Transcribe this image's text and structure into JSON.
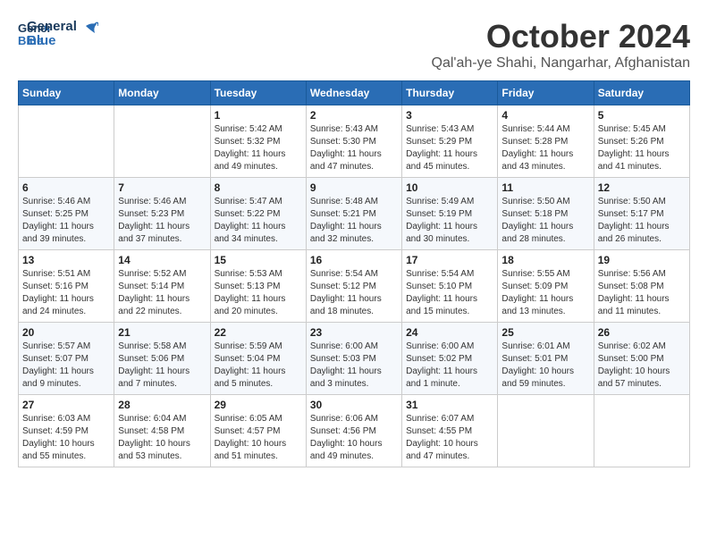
{
  "header": {
    "logo_line1": "General",
    "logo_line2": "Blue",
    "month": "October 2024",
    "location": "Qal'ah-ye Shahi, Nangarhar, Afghanistan"
  },
  "weekdays": [
    "Sunday",
    "Monday",
    "Tuesday",
    "Wednesday",
    "Thursday",
    "Friday",
    "Saturday"
  ],
  "weeks": [
    [
      {
        "day": "",
        "detail": ""
      },
      {
        "day": "",
        "detail": ""
      },
      {
        "day": "1",
        "detail": "Sunrise: 5:42 AM\nSunset: 5:32 PM\nDaylight: 11 hours and 49 minutes."
      },
      {
        "day": "2",
        "detail": "Sunrise: 5:43 AM\nSunset: 5:30 PM\nDaylight: 11 hours and 47 minutes."
      },
      {
        "day": "3",
        "detail": "Sunrise: 5:43 AM\nSunset: 5:29 PM\nDaylight: 11 hours and 45 minutes."
      },
      {
        "day": "4",
        "detail": "Sunrise: 5:44 AM\nSunset: 5:28 PM\nDaylight: 11 hours and 43 minutes."
      },
      {
        "day": "5",
        "detail": "Sunrise: 5:45 AM\nSunset: 5:26 PM\nDaylight: 11 hours and 41 minutes."
      }
    ],
    [
      {
        "day": "6",
        "detail": "Sunrise: 5:46 AM\nSunset: 5:25 PM\nDaylight: 11 hours and 39 minutes."
      },
      {
        "day": "7",
        "detail": "Sunrise: 5:46 AM\nSunset: 5:23 PM\nDaylight: 11 hours and 37 minutes."
      },
      {
        "day": "8",
        "detail": "Sunrise: 5:47 AM\nSunset: 5:22 PM\nDaylight: 11 hours and 34 minutes."
      },
      {
        "day": "9",
        "detail": "Sunrise: 5:48 AM\nSunset: 5:21 PM\nDaylight: 11 hours and 32 minutes."
      },
      {
        "day": "10",
        "detail": "Sunrise: 5:49 AM\nSunset: 5:19 PM\nDaylight: 11 hours and 30 minutes."
      },
      {
        "day": "11",
        "detail": "Sunrise: 5:50 AM\nSunset: 5:18 PM\nDaylight: 11 hours and 28 minutes."
      },
      {
        "day": "12",
        "detail": "Sunrise: 5:50 AM\nSunset: 5:17 PM\nDaylight: 11 hours and 26 minutes."
      }
    ],
    [
      {
        "day": "13",
        "detail": "Sunrise: 5:51 AM\nSunset: 5:16 PM\nDaylight: 11 hours and 24 minutes."
      },
      {
        "day": "14",
        "detail": "Sunrise: 5:52 AM\nSunset: 5:14 PM\nDaylight: 11 hours and 22 minutes."
      },
      {
        "day": "15",
        "detail": "Sunrise: 5:53 AM\nSunset: 5:13 PM\nDaylight: 11 hours and 20 minutes."
      },
      {
        "day": "16",
        "detail": "Sunrise: 5:54 AM\nSunset: 5:12 PM\nDaylight: 11 hours and 18 minutes."
      },
      {
        "day": "17",
        "detail": "Sunrise: 5:54 AM\nSunset: 5:10 PM\nDaylight: 11 hours and 15 minutes."
      },
      {
        "day": "18",
        "detail": "Sunrise: 5:55 AM\nSunset: 5:09 PM\nDaylight: 11 hours and 13 minutes."
      },
      {
        "day": "19",
        "detail": "Sunrise: 5:56 AM\nSunset: 5:08 PM\nDaylight: 11 hours and 11 minutes."
      }
    ],
    [
      {
        "day": "20",
        "detail": "Sunrise: 5:57 AM\nSunset: 5:07 PM\nDaylight: 11 hours and 9 minutes."
      },
      {
        "day": "21",
        "detail": "Sunrise: 5:58 AM\nSunset: 5:06 PM\nDaylight: 11 hours and 7 minutes."
      },
      {
        "day": "22",
        "detail": "Sunrise: 5:59 AM\nSunset: 5:04 PM\nDaylight: 11 hours and 5 minutes."
      },
      {
        "day": "23",
        "detail": "Sunrise: 6:00 AM\nSunset: 5:03 PM\nDaylight: 11 hours and 3 minutes."
      },
      {
        "day": "24",
        "detail": "Sunrise: 6:00 AM\nSunset: 5:02 PM\nDaylight: 11 hours and 1 minute."
      },
      {
        "day": "25",
        "detail": "Sunrise: 6:01 AM\nSunset: 5:01 PM\nDaylight: 10 hours and 59 minutes."
      },
      {
        "day": "26",
        "detail": "Sunrise: 6:02 AM\nSunset: 5:00 PM\nDaylight: 10 hours and 57 minutes."
      }
    ],
    [
      {
        "day": "27",
        "detail": "Sunrise: 6:03 AM\nSunset: 4:59 PM\nDaylight: 10 hours and 55 minutes."
      },
      {
        "day": "28",
        "detail": "Sunrise: 6:04 AM\nSunset: 4:58 PM\nDaylight: 10 hours and 53 minutes."
      },
      {
        "day": "29",
        "detail": "Sunrise: 6:05 AM\nSunset: 4:57 PM\nDaylight: 10 hours and 51 minutes."
      },
      {
        "day": "30",
        "detail": "Sunrise: 6:06 AM\nSunset: 4:56 PM\nDaylight: 10 hours and 49 minutes."
      },
      {
        "day": "31",
        "detail": "Sunrise: 6:07 AM\nSunset: 4:55 PM\nDaylight: 10 hours and 47 minutes."
      },
      {
        "day": "",
        "detail": ""
      },
      {
        "day": "",
        "detail": ""
      }
    ]
  ]
}
